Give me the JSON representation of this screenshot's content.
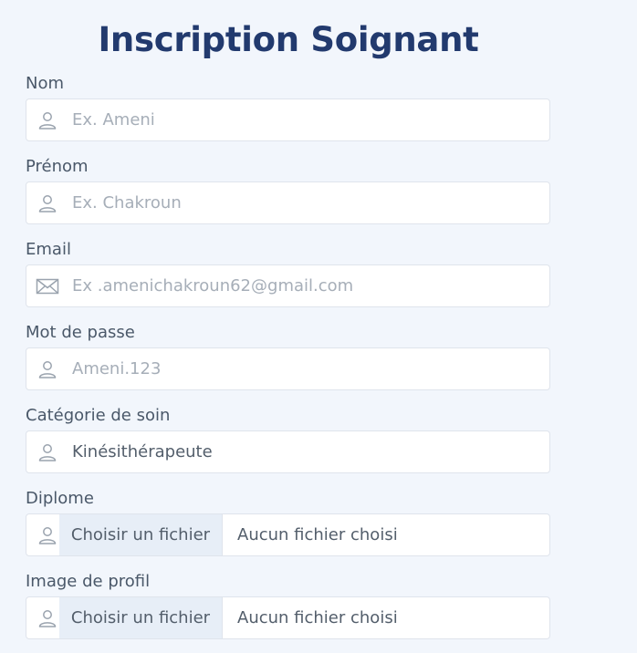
{
  "title": "Inscription Soignant",
  "fields": {
    "nom": {
      "label": "Nom",
      "placeholder": "Ex. Ameni",
      "icon": "user-icon"
    },
    "prenom": {
      "label": "Prénom",
      "placeholder": "Ex. Chakroun",
      "icon": "user-icon"
    },
    "email": {
      "label": "Email",
      "placeholder": "Ex .amenichakroun62@gmail.com",
      "icon": "envelope-icon"
    },
    "password": {
      "label": "Mot de passe",
      "placeholder": "Ameni.123",
      "icon": "user-icon"
    },
    "categorie": {
      "label": "Catégorie de soin",
      "value": "Kinésithérapeute",
      "icon": "user-icon"
    },
    "diplome": {
      "label": "Diplome",
      "button": "Choisir un fichier",
      "file_status": "Aucun fichier choisi",
      "icon": "user-icon"
    },
    "image": {
      "label": "Image de profil",
      "button": "Choisir un fichier",
      "file_status": "Aucun fichier choisi",
      "icon": "user-icon"
    }
  },
  "colors": {
    "background": "#f2f6fc",
    "title": "#223a6e",
    "label": "#4a5869",
    "placeholder": "#a6aeb8",
    "border": "#dfe4ec",
    "file_button_bg": "#e7eef7"
  }
}
